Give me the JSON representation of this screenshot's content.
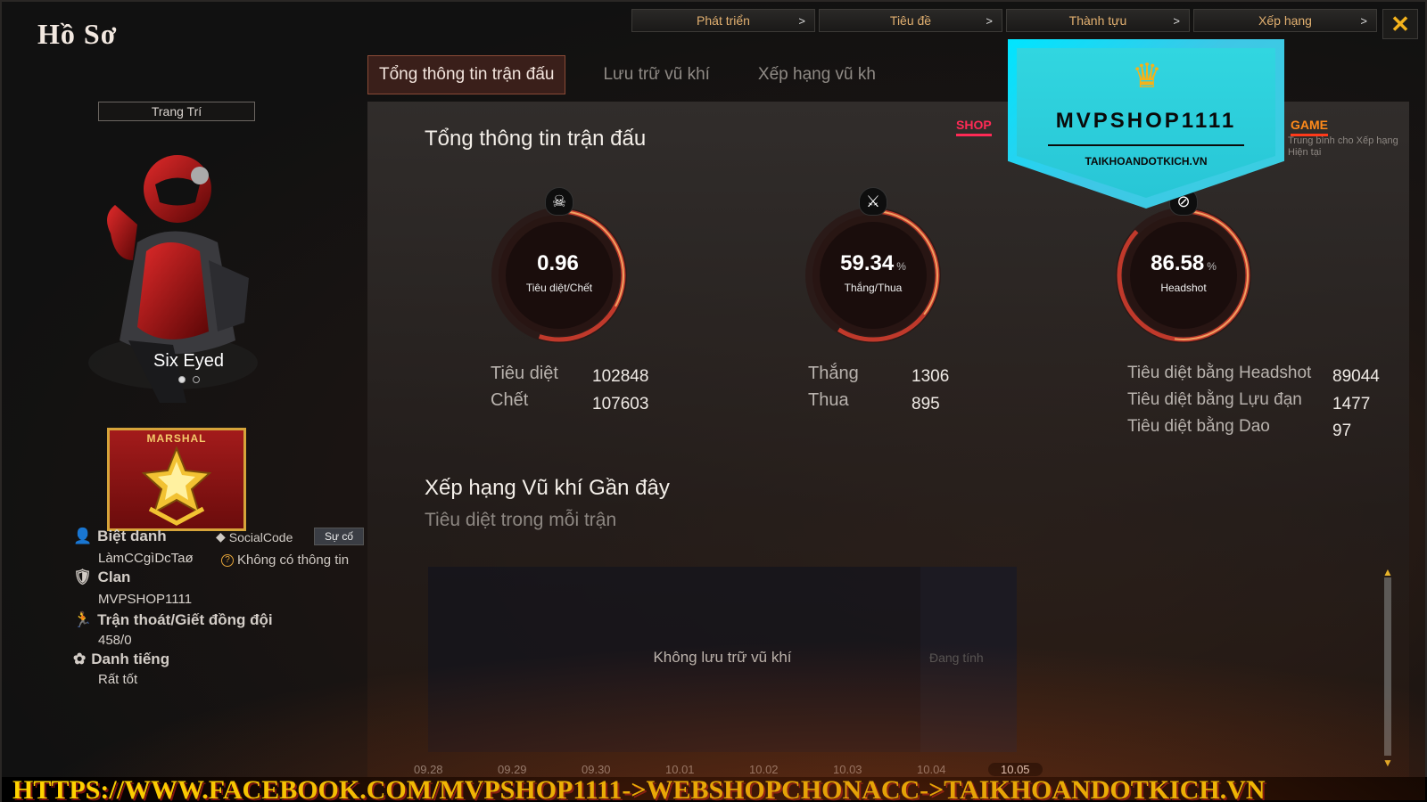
{
  "window": {
    "title": "Hồ Sơ",
    "close_label": "✕"
  },
  "top_nav": [
    {
      "label": "Phát triển"
    },
    {
      "label": "Tiêu đề"
    },
    {
      "label": "Thành tựu"
    },
    {
      "label": "Xếp hạng"
    }
  ],
  "tabs": [
    {
      "label": "Tổng thông tin trận đấu",
      "active": true
    },
    {
      "label": "Lưu trữ vũ khí",
      "active": false
    },
    {
      "label": "Xếp hạng vũ kh",
      "active": false
    }
  ],
  "sidebar": {
    "trang_tri": "Trang Trí",
    "character_name": "Six Eyed",
    "rank_label": "MARSHAL",
    "nickname_label": "Biệt danh",
    "nickname_value": "LàmCCgìDcTaø",
    "socialcode_label": "SocialCode",
    "su_co_label": "Sự cố",
    "no_info": "Không có thông tin",
    "clan_label": "Clan",
    "clan_value": "MVPSHOP1111",
    "escape_label": "Trận thoát/Giết đồng đội",
    "escape_value": "458/0",
    "reputation_label": "Danh tiếng",
    "reputation_value": "Rất tốt"
  },
  "panel": {
    "title": "Tổng thông tin trận đấu",
    "shop_tab": "SHOP",
    "game_tab": "GAME",
    "game_sub": "Trung bình cho Xếp hạng Hiện tại"
  },
  "gauges": [
    {
      "value": "0.96",
      "pct": "",
      "label": "Tiêu diệt/Chết",
      "icon": "skull-icon",
      "fill": 0.55
    },
    {
      "value": "59.34",
      "pct": "%",
      "label": "Thắng/Thua",
      "icon": "crossed-swords-icon",
      "fill": 0.59
    },
    {
      "value": "86.58",
      "pct": "%",
      "label": "Headshot",
      "icon": "headshot-icon",
      "fill": 0.87
    }
  ],
  "stats": {
    "kills_label": "Tiêu diệt",
    "kills_value": "102848",
    "deaths_label": "Chết",
    "deaths_value": "107603",
    "wins_label": "Thắng",
    "wins_value": "1306",
    "losses_label": "Thua",
    "losses_value": "895",
    "hs_label": "Tiêu diệt bằng Headshot",
    "hs_value": "89044",
    "grenade_label": "Tiêu diệt bằng Lựu đạn",
    "grenade_value": "1477",
    "knife_label": "Tiêu diệt bằng Dao",
    "knife_value": "97"
  },
  "weapon_section": {
    "title": "Xếp hạng Vũ khí Gần đây",
    "subtitle": "Tiêu diệt trong mỗi trận",
    "empty_text": "Không lưu trữ vũ khí",
    "calculating": "Đang tính",
    "dates": [
      "09.28",
      "09.29",
      "09.30",
      "10.01",
      "10.02",
      "10.03",
      "10.04",
      "10.05"
    ]
  },
  "watermark": {
    "name": "MVPSHOP1111",
    "domain": "TAIKHOANDOTKICH.VN",
    "bottom_url": "HTTPS://WWW.FACEBOOK.COM/MVPSHOP1111->WEBSHOPCHONACC->TAIKHOANDOTKICH.VN"
  },
  "colors": {
    "accent_gold": "#e2b070",
    "shop_red": "#ff2a55",
    "game_orange": "#ff8a1a",
    "gauge_red": "#c0392b",
    "watermark_cyan": "#31d6e0"
  }
}
